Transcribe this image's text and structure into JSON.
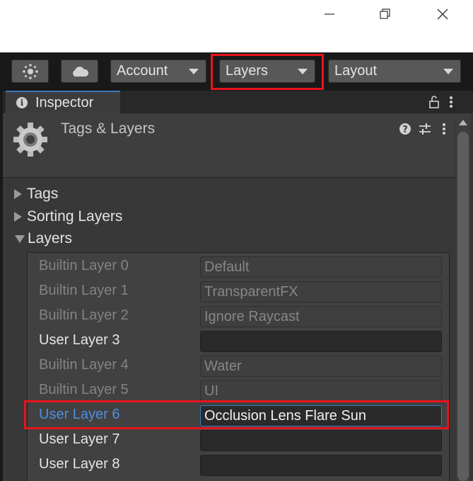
{
  "window": {
    "controls": {
      "minimize": "minimize-icon",
      "restore": "restore-icon",
      "close": "close-icon"
    }
  },
  "toolbar": {
    "collab_icon": "collab-icon",
    "cloud_icon": "cloud-icon",
    "account_label": "Account",
    "layers_label": "Layers",
    "layout_label": "Layout"
  },
  "inspector": {
    "tab_label": "Inspector",
    "lock_icon": "lock-icon",
    "menu_icon": "kebab-menu-icon",
    "header": {
      "title": "Tags & Layers",
      "icon": "gear-icon",
      "help_icon": "help-icon",
      "presets_icon": "sliders-icon",
      "menu_icon": "kebab-menu-icon"
    },
    "sections": [
      {
        "label": "Tags",
        "expanded": false
      },
      {
        "label": "Sorting Layers",
        "expanded": false
      },
      {
        "label": "Layers",
        "expanded": true
      }
    ],
    "layers": [
      {
        "label": "Builtin Layer 0",
        "value": "Default",
        "kind": "builtin"
      },
      {
        "label": "Builtin Layer 1",
        "value": "TransparentFX",
        "kind": "builtin"
      },
      {
        "label": "Builtin Layer 2",
        "value": "Ignore Raycast",
        "kind": "builtin"
      },
      {
        "label": "User Layer 3",
        "value": "",
        "kind": "user"
      },
      {
        "label": "Builtin Layer 4",
        "value": "Water",
        "kind": "builtin"
      },
      {
        "label": "Builtin Layer 5",
        "value": "UI",
        "kind": "builtin"
      },
      {
        "label": "User Layer 6",
        "value": "Occlusion Lens Flare Sun",
        "kind": "selected"
      },
      {
        "label": "User Layer 7",
        "value": "",
        "kind": "user"
      },
      {
        "label": "User Layer 8",
        "value": "",
        "kind": "user"
      }
    ]
  },
  "colors": {
    "highlight": "#e8141c",
    "accent": "#3a79bb",
    "selected_text": "#4e8ee3"
  }
}
